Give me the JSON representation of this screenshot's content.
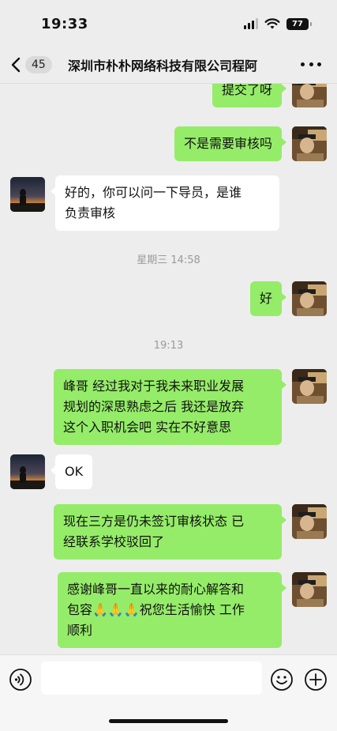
{
  "status_bar": {
    "time": "19:33",
    "battery": "77"
  },
  "nav": {
    "unread_count": "45",
    "title": "深圳市朴朴网络科技有限公司程阿"
  },
  "chat": {
    "messages": [
      {
        "from": "me",
        "lines": [
          "提交了呀"
        ]
      },
      {
        "from": "me",
        "lines": [
          "不是需要审核吗"
        ]
      },
      {
        "from": "other",
        "lines": [
          "好的，你可以问一下导员，是谁",
          "负责审核"
        ]
      },
      {
        "timestamp": "星期三 14:58"
      },
      {
        "from": "me",
        "lines": [
          "好"
        ]
      },
      {
        "timestamp": "19:13"
      },
      {
        "from": "me",
        "lines": [
          "峰哥 经过我对于我未来职业发展",
          "规划的深思熟虑之后 我还是放弃",
          "这个入职机会吧 实在不好意思"
        ]
      },
      {
        "from": "other",
        "lines": [
          "OK"
        ]
      },
      {
        "from": "me",
        "lines": [
          "现在三方是仍未签订审核状态 已",
          "经联系学校驳回了"
        ]
      },
      {
        "from": "me",
        "lines": [
          "感谢峰哥一直以来的耐心解答和",
          "包容🙏🙏🙏祝您生活愉快 工作",
          "顺利"
        ]
      }
    ]
  },
  "input": {
    "placeholder": ""
  },
  "colors": {
    "my_bubble": "#95ec69",
    "their_bubble": "#ffffff",
    "background": "#ededed"
  },
  "icons": {
    "back": "chevron-left-icon",
    "more": "more-dots-icon",
    "voice": "voice-icon",
    "emoji": "emoji-icon",
    "plus": "plus-icon"
  }
}
